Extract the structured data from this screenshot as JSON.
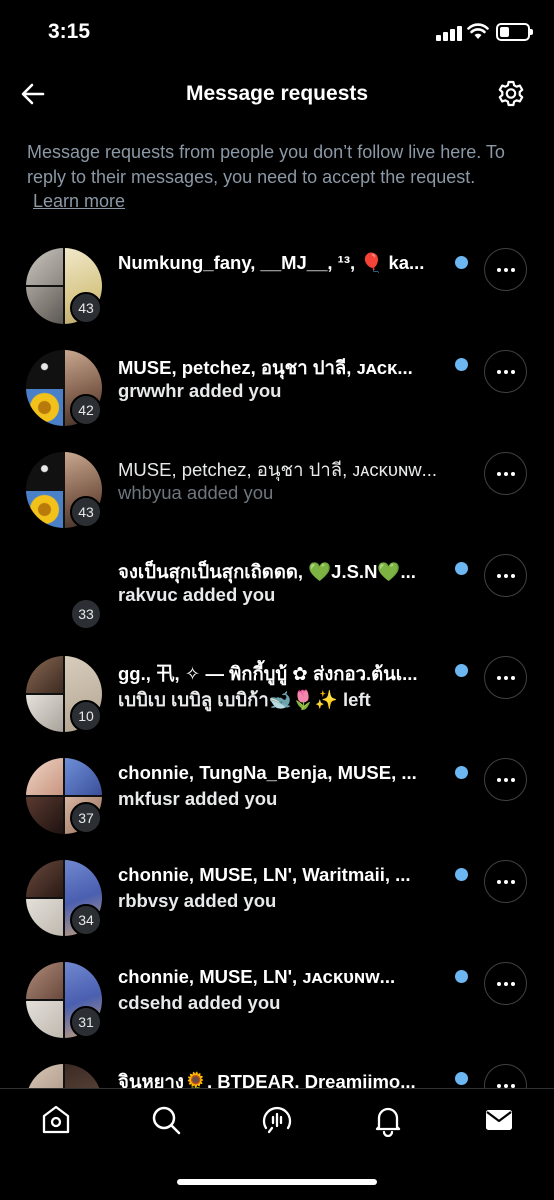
{
  "status_bar": {
    "time": "3:15"
  },
  "header": {
    "title": "Message requests"
  },
  "info": {
    "text": "Message requests from people you don’t follow live here. To reply to their messages, you need to accept the request.",
    "learn_more": "Learn more"
  },
  "requests": [
    {
      "names": "Numkung_fany, __MJ__, ¹³, 🎈 ka...",
      "subtitle": "",
      "count": "43",
      "unread": true
    },
    {
      "names": "MUSE, petchez, อนุชา ปาลี, ᴊᴀᴄᴋ...",
      "subtitle": "grwwhr added you",
      "count": "42",
      "unread": true
    },
    {
      "names": "MUSE, petchez, อนุชา ปาลี, ᴊᴀᴄᴋᴜɴᴡ...",
      "subtitle": "whbyua added you",
      "count": "43",
      "unread": false
    },
    {
      "names": "จงเป็นสุกเป็นสุกเถิดดด, 💚J.S.N💚...",
      "subtitle": "rakvuc added you",
      "count": "33",
      "unread": true
    },
    {
      "names": "gg., 卂, ✧ — พิกกี้บูบู้ ✿ ส่งกอว.ต้นเ...",
      "subtitle": "เบบิเบ เบบิลู เบบิก้า🐋🌷✨ left",
      "count": "10",
      "unread": true
    },
    {
      "names": "chonnie, TungNa_Benja, MUSE, ...",
      "subtitle": "mkfusr added you",
      "count": "37",
      "unread": true
    },
    {
      "names": "chonnie, MUSE, LN', Waritmaii, ...",
      "subtitle": "rbbvsy added you",
      "count": "34",
      "unread": true
    },
    {
      "names": "chonnie, MUSE, LN', ᴊᴀᴄᴋᴜɴᴡ...",
      "subtitle": "cdsehd added you",
      "count": "31",
      "unread": true
    },
    {
      "names": "จินหยาง🌻, BTDEAR, Dreamiimo...",
      "subtitle": "",
      "count": "",
      "unread": true
    }
  ],
  "tabs": [
    {
      "icon": "home-icon"
    },
    {
      "icon": "search-icon"
    },
    {
      "icon": "spaces-icon"
    },
    {
      "icon": "notifications-icon"
    },
    {
      "icon": "messages-icon"
    }
  ],
  "colors": {
    "accent_dot": "#6cb6f2",
    "muted_text": "#8b98a5",
    "background": "#000000"
  }
}
